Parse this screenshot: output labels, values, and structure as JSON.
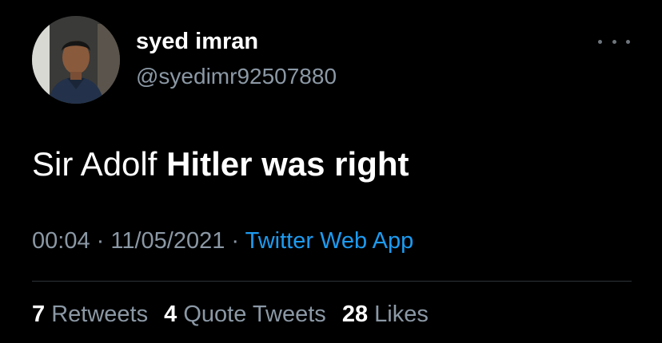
{
  "user": {
    "display_name": "syed imran",
    "handle": "@syedimr92507880",
    "avatar": "user-avatar-photo"
  },
  "tweet": {
    "text_normal": "Sir Adolf ",
    "text_bold": "Hitler was right"
  },
  "meta": {
    "time": "00:04",
    "sep1": " · ",
    "date": "11/05/2021",
    "sep2": " · ",
    "source": "Twitter Web App"
  },
  "stats": {
    "retweets_count": "7",
    "retweets_label": "Retweets",
    "quotes_count": "4",
    "quotes_label": "Quote Tweets",
    "likes_count": "28",
    "likes_label": "Likes"
  },
  "icons": {
    "more": "more-horizontal-icon"
  },
  "colors": {
    "background": "#000000",
    "primary_text": "#ffffff",
    "secondary_text": "#8b98a5",
    "link": "#1d9bf0",
    "divider": "#2f3336"
  }
}
